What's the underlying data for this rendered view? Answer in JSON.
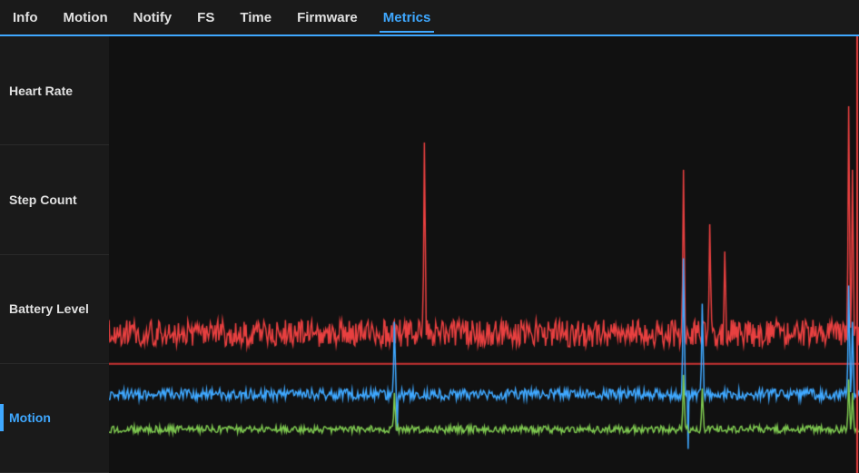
{
  "nav": {
    "items": [
      {
        "label": "Info",
        "active": false
      },
      {
        "label": "Motion",
        "active": false
      },
      {
        "label": "Notify",
        "active": false
      },
      {
        "label": "FS",
        "active": false
      },
      {
        "label": "Time",
        "active": false
      },
      {
        "label": "Firmware",
        "active": false
      },
      {
        "label": "Metrics",
        "active": true
      }
    ]
  },
  "sidebar": {
    "items": [
      {
        "label": "Heart Rate",
        "active": false
      },
      {
        "label": "Step Count",
        "active": false
      },
      {
        "label": "Battery Level",
        "active": false
      },
      {
        "label": "Motion",
        "active": true
      }
    ]
  },
  "chart": {
    "colors": {
      "red": "#e84040",
      "blue": "#3fa8ff",
      "green": "#7ec850",
      "horizontal_line": "#e84040"
    }
  }
}
